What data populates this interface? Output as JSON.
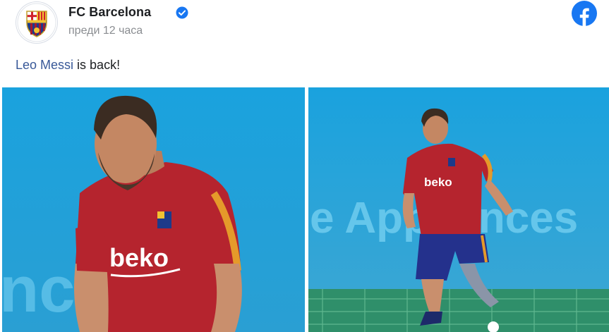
{
  "post": {
    "author": "FC Barcelona",
    "timestamp": "преди 12 часа",
    "text_mention": "Leo Messi",
    "text_rest": " is back!",
    "brand_icon": "facebook-icon",
    "verified_icon": "verified-badge-icon"
  },
  "photos": {
    "left": {
      "shirt_sponsor": "beko",
      "background_text": "nc"
    },
    "right": {
      "shirt_sponsor": "beko",
      "background_text": "e Appliances"
    }
  },
  "colors": {
    "facebook_blue": "#1877f2",
    "mention_blue": "#385898",
    "sky_blue": "#1ea0d8",
    "jersey_red": "#b5242e",
    "shorts_blue": "#24318c"
  }
}
